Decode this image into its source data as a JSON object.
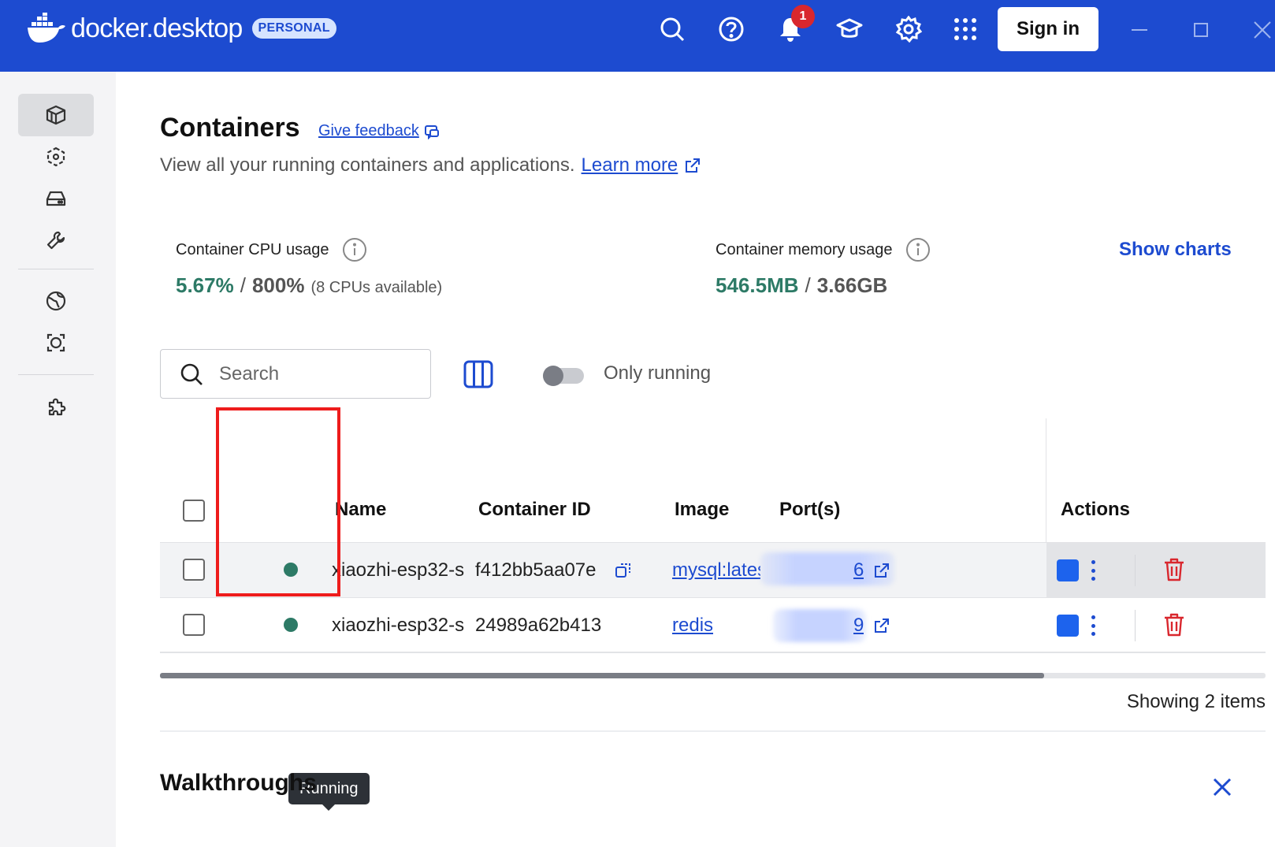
{
  "header": {
    "brand_docker": "docker",
    "brand_desktop": "desktop",
    "plan_badge": "PERSONAL",
    "notification_count": "1",
    "sign_in_label": "Sign in",
    "icons": [
      "search-icon",
      "help-icon",
      "bell-icon",
      "learning-center-icon",
      "settings-icon",
      "apps-grid-icon"
    ]
  },
  "sidebar": {
    "items": [
      {
        "icon": "containers-icon",
        "active": true
      },
      {
        "icon": "images-icon",
        "active": false
      },
      {
        "icon": "volumes-icon",
        "active": false
      },
      {
        "icon": "builds-icon",
        "active": false
      },
      {
        "icon": "docker-hub-icon",
        "active": false
      },
      {
        "icon": "docker-scout-icon",
        "active": false
      },
      {
        "icon": "extensions-icon",
        "active": false
      }
    ]
  },
  "main": {
    "title": "Containers",
    "feedback_link": "Give feedback",
    "subtitle": "View all your running containers and applications.",
    "learn_more": "Learn more",
    "cpu": {
      "label": "Container CPU usage",
      "used": "5.67%",
      "separator": "/",
      "total": "800%",
      "note": "(8 CPUs available)"
    },
    "memory": {
      "label": "Container memory usage",
      "used": "546.5MB",
      "separator": "/",
      "total": "3.66GB"
    },
    "show_charts": "Show charts",
    "search_placeholder": "Search",
    "only_running_label": "Only running",
    "only_running_on": false
  },
  "table": {
    "headers": {
      "name": "Name",
      "container_id": "Container ID",
      "image": "Image",
      "ports": "Port(s)",
      "actions": "Actions"
    },
    "rows": [
      {
        "status": "Running",
        "name": "xiaozhi-esp32-s",
        "container_id": "f412bb5aa07e",
        "image": "mysql:lates",
        "port_partial": "6"
      },
      {
        "status": "Running",
        "name": "xiaozhi-esp32-s",
        "container_id": "24989a62b413",
        "image": "redis",
        "port_partial": "9"
      }
    ],
    "tooltip": "Running",
    "horizontal_scroll_fraction": 0.8,
    "showing": "Showing 2 items"
  },
  "walkthroughs": {
    "title": "Walkthroughs"
  },
  "colors": {
    "header_bg": "#1d4bd0",
    "accent": "#1d4bd0",
    "running_green": "#2d7a66",
    "delete_red": "#d9272e",
    "annotation_red": "#ee1c1c"
  }
}
